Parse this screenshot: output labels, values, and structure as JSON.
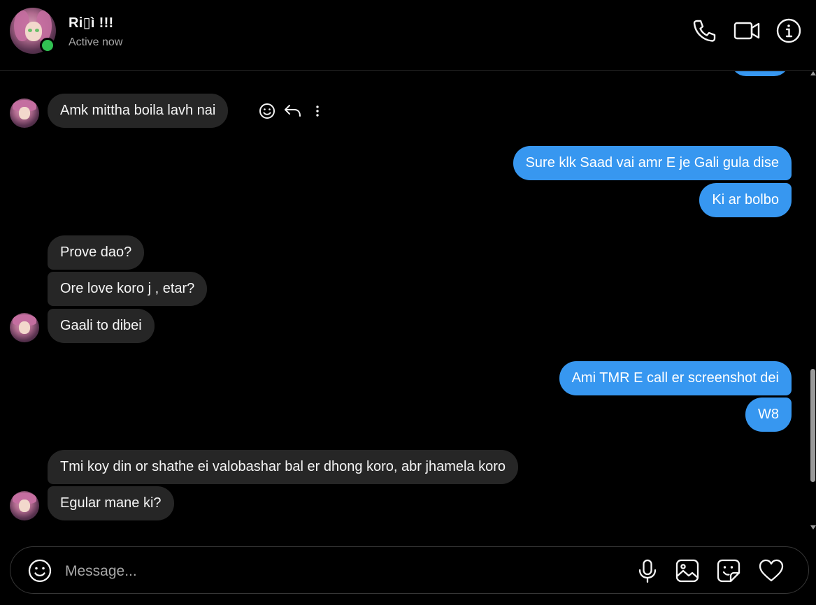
{
  "header": {
    "name": "Ri▯ì !!!",
    "status": "Active now",
    "icons": [
      "phone-icon",
      "video-call-icon",
      "info-icon"
    ]
  },
  "messages": [
    {
      "side": "outgoing",
      "text": ""
    },
    {
      "side": "incoming",
      "text": "Amk mittha boila lavh nai"
    },
    {
      "side": "outgoing",
      "text": "Sure klk Saad vai amr E je Gali gula dise"
    },
    {
      "side": "outgoing",
      "text": "Ki ar bolbo"
    },
    {
      "side": "incoming",
      "text": "Prove dao?"
    },
    {
      "side": "incoming",
      "text": "Ore love koro j , etar?"
    },
    {
      "side": "incoming",
      "text": "Gaali to dibei"
    },
    {
      "side": "outgoing",
      "text": "Ami TMR E call er screenshot dei"
    },
    {
      "side": "outgoing",
      "text": "W8"
    },
    {
      "side": "incoming",
      "text": "Tmi koy din or shathe ei valobashar bal er dhong koro, abr jhamela koro"
    },
    {
      "side": "incoming",
      "text": "Egular mane ki?"
    }
  ],
  "hover_actions": [
    "emoji-react-icon",
    "reply-icon",
    "more-options-icon"
  ],
  "composer": {
    "placeholder": "Message...",
    "icons": [
      "emoji-icon",
      "microphone-icon",
      "image-icon",
      "sticker-icon",
      "heart-icon"
    ]
  },
  "colors": {
    "background": "#000000",
    "incoming_bubble": "#262626",
    "outgoing_bubble": "#3797f0",
    "online": "#31c152"
  }
}
